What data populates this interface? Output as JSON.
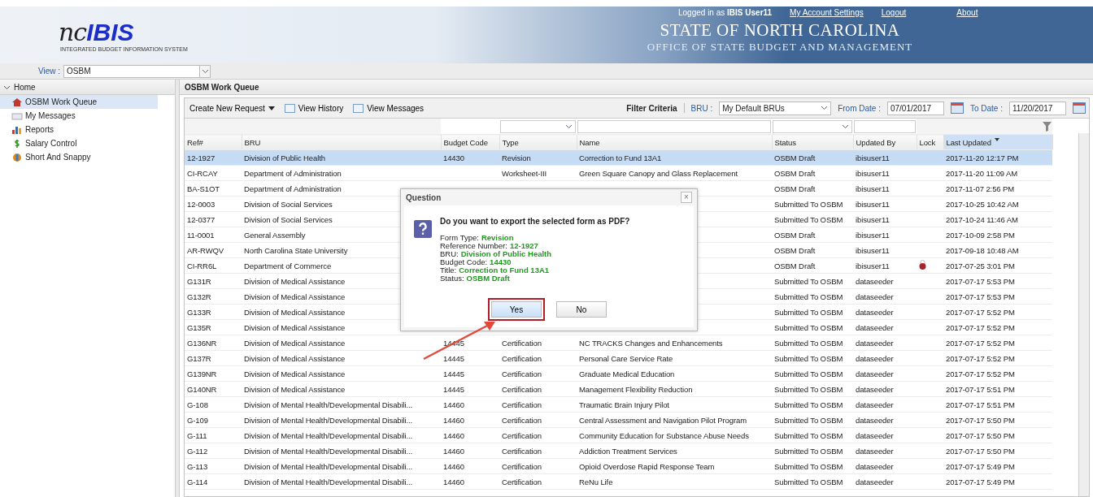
{
  "header": {
    "logo_script": "nc",
    "logo_bold": "IBIS",
    "logo_tagline": "INTEGRATED BUDGET INFORMATION SYSTEM",
    "login_text": "Logged in as **IBIS User11**",
    "links": [
      "My Account Settings",
      "Logout",
      "About"
    ],
    "title": "STATE OF NORTH CAROLINA",
    "subtitle": "OFFICE OF STATE BUDGET AND MANAGEMENT"
  },
  "view": {
    "label": "View :",
    "value": "OSBM"
  },
  "sidebar": {
    "root": {
      "label": "Home",
      "expanded": true,
      "children": [
        {
          "label": "OSBM Work Queue",
          "kind": "house",
          "selected": true
        },
        {
          "label": "My Messages",
          "kind": "mail",
          "selected": false
        },
        {
          "label": "Reports",
          "kind": "chart",
          "selected": false
        },
        {
          "label": "Salary Control",
          "kind": "dollar",
          "selected": false
        },
        {
          "label": "Short And Snappy",
          "kind": "flash",
          "selected": false
        }
      ]
    }
  },
  "panel": {
    "title": "OSBM Work Queue",
    "toolbar": {
      "create": "Create New Request",
      "history": "View History",
      "messages": "View Messages"
    },
    "filter": {
      "label": "Filter Criteria",
      "bru_label": "BRU :",
      "bru_value": "My Default BRUs",
      "from_label": "From Date :",
      "from_value": "07/01/2017",
      "to_label": "To Date :",
      "to_value": "11/20/2017"
    },
    "columns": [
      {
        "label": "Ref#",
        "sorted": false
      },
      {
        "label": "BRU",
        "sorted": false
      },
      {
        "label": "Budget Code",
        "sorted": false
      },
      {
        "label": "Type",
        "sorted": false
      },
      {
        "label": "Name",
        "sorted": false
      },
      {
        "label": "Status",
        "sorted": false
      },
      {
        "label": "Updated By",
        "sorted": false
      },
      {
        "label": "Lock",
        "sorted": false
      },
      {
        "label": "Last Updated",
        "sorted": true
      }
    ],
    "rows": [
      {
        "ref": "12-1927",
        "bru": "Division of Public Health",
        "budget_code": "14430",
        "type": "Revision",
        "name": "Correction to Fund 13A1",
        "status": "OSBM Draft",
        "updated_by": "ibisuser11",
        "locked": false,
        "last_updated": "2017-11-20 12:17 PM",
        "selected": true
      },
      {
        "ref": "CI-RCAY",
        "bru": "Department of Administration",
        "type": "Worksheet-III",
        "name": "Green Square Canopy and Glass Replacement",
        "status": "OSBM Draft",
        "updated_by": "ibisuser11",
        "locked": false,
        "last_updated": "2017-11-20 11:09 AM",
        "selected": false
      },
      {
        "ref": "BA-S1OT",
        "bru": "Department of Administration",
        "status": "OSBM Draft",
        "updated_by": "ibisuser11",
        "locked": false,
        "last_updated": "2017-11-07 2:56 PM",
        "selected": false
      },
      {
        "ref": "12-0003",
        "bru": "Division of Social Services",
        "status": "Submitted To OSBM",
        "updated_by": "ibisuser11",
        "locked": false,
        "last_updated": "2017-10-25 10:42 AM",
        "selected": false
      },
      {
        "ref": "12-0377",
        "bru": "Division of Social Services",
        "status": "Submitted To OSBM",
        "updated_by": "ibisuser11",
        "locked": false,
        "last_updated": "2017-10-24 11:46 AM",
        "selected": false
      },
      {
        "ref": "11-0001",
        "bru": "General Assembly",
        "status": "OSBM Draft",
        "updated_by": "ibisuser11",
        "locked": false,
        "last_updated": "2017-10-09 2:58 PM",
        "selected": false
      },
      {
        "ref": "AR-RWQV",
        "bru": "North Carolina State University",
        "status": "OSBM Draft",
        "updated_by": "ibisuser11",
        "locked": false,
        "last_updated": "2017-09-18 10:48 AM",
        "selected": false
      },
      {
        "ref": "CI-RR6L",
        "bru": "Department of Commerce",
        "status": "OSBM Draft",
        "updated_by": "ibisuser11",
        "locked": true,
        "last_updated": "2017-07-25 3:01 PM",
        "selected": false
      },
      {
        "ref": "G131R",
        "bru": "Division of Medical Assistance",
        "status": "Submitted To OSBM",
        "updated_by": "dataseeder",
        "locked": false,
        "last_updated": "2017-07-17 5:53 PM",
        "selected": false
      },
      {
        "ref": "G132R",
        "bru": "Division of Medical Assistance",
        "status": "Submitted To OSBM",
        "updated_by": "dataseeder",
        "locked": false,
        "last_updated": "2017-07-17 5:53 PM",
        "selected": false
      },
      {
        "ref": "G133R",
        "bru": "Division of Medical Assistance",
        "status": "Submitted To OSBM",
        "updated_by": "dataseeder",
        "locked": false,
        "last_updated": "2017-07-17 5:52 PM",
        "selected": false
      },
      {
        "ref": "G135R",
        "bru": "Division of Medical Assistance",
        "status": "Submitted To OSBM",
        "updated_by": "dataseeder",
        "locked": false,
        "last_updated": "2017-07-17 5:52 PM",
        "selected": false
      },
      {
        "ref": "G136NR",
        "bru": "Division of Medical Assistance",
        "budget_code": "14445",
        "type": "Certification",
        "name": "NC TRACKS Changes and Enhancements",
        "status": "Submitted To OSBM",
        "updated_by": "dataseeder",
        "locked": false,
        "last_updated": "2017-07-17 5:52 PM",
        "selected": false
      },
      {
        "ref": "G137R",
        "bru": "Division of Medical Assistance",
        "budget_code": "14445",
        "type": "Certification",
        "name": "Personal Care Service Rate",
        "status": "Submitted To OSBM",
        "updated_by": "dataseeder",
        "locked": false,
        "last_updated": "2017-07-17 5:52 PM",
        "selected": false
      },
      {
        "ref": "G139NR",
        "bru": "Division of Medical Assistance",
        "budget_code": "14445",
        "type": "Certification",
        "name": "Graduate Medical Education",
        "status": "Submitted To OSBM",
        "updated_by": "dataseeder",
        "locked": false,
        "last_updated": "2017-07-17 5:52 PM",
        "selected": false
      },
      {
        "ref": "G140NR",
        "bru": "Division of Medical Assistance",
        "budget_code": "14445",
        "type": "Certification",
        "name": "Management Flexibility Reduction",
        "status": "Submitted To OSBM",
        "updated_by": "dataseeder",
        "locked": false,
        "last_updated": "2017-07-17 5:51 PM",
        "selected": false
      },
      {
        "ref": "G-108",
        "bru": "Division of Mental Health/Developmental Disabili...",
        "budget_code": "14460",
        "type": "Certification",
        "name": "Traumatic Brain Injury Pilot",
        "status": "Submitted To OSBM",
        "updated_by": "dataseeder",
        "locked": false,
        "last_updated": "2017-07-17 5:51 PM",
        "selected": false
      },
      {
        "ref": "G-109",
        "bru": "Division of Mental Health/Developmental Disabili...",
        "budget_code": "14460",
        "type": "Certification",
        "name": "Central Assessment and Navigation Pilot Program",
        "status": "Submitted To OSBM",
        "updated_by": "dataseeder",
        "locked": false,
        "last_updated": "2017-07-17 5:50 PM",
        "selected": false
      },
      {
        "ref": "G-111",
        "bru": "Division of Mental Health/Developmental Disabili...",
        "budget_code": "14460",
        "type": "Certification",
        "name": "Community Education for Substance Abuse Needs",
        "status": "Submitted To OSBM",
        "updated_by": "dataseeder",
        "locked": false,
        "last_updated": "2017-07-17 5:50 PM",
        "selected": false
      },
      {
        "ref": "G-112",
        "bru": "Division of Mental Health/Developmental Disabili...",
        "budget_code": "14460",
        "type": "Certification",
        "name": "Addiction Treatment Services",
        "status": "Submitted To OSBM",
        "updated_by": "dataseeder",
        "locked": false,
        "last_updated": "2017-07-17 5:50 PM",
        "selected": false
      },
      {
        "ref": "G-113",
        "bru": "Division of Mental Health/Developmental Disabili...",
        "budget_code": "14460",
        "type": "Certification",
        "name": "Opioid Overdose Rapid Response Team",
        "status": "Submitted To OSBM",
        "updated_by": "dataseeder",
        "locked": false,
        "last_updated": "2017-07-17 5:49 PM",
        "selected": false
      },
      {
        "ref": "G-114",
        "bru": "Division of Mental Health/Developmental Disabili...",
        "budget_code": "14460",
        "type": "Certification",
        "name": "ReNu Life",
        "status": "Submitted To OSBM",
        "updated_by": "dataseeder",
        "locked": false,
        "last_updated": "2017-07-17 5:49 PM",
        "selected": false
      }
    ]
  },
  "dialog": {
    "title": "Question",
    "close": "×",
    "question": "Do you want to export the selected form as PDF?",
    "details": [
      {
        "label": "Form Type:",
        "value": "Revision"
      },
      {
        "label": "Reference Number:",
        "value": "12-1927"
      },
      {
        "label": "BRU:",
        "value": "Division of Public Health"
      },
      {
        "label": "Budget Code:",
        "value": "14430"
      },
      {
        "label": "Title:",
        "value": "Correction to Fund 13A1"
      },
      {
        "label": "Status:",
        "value": "OSBM Draft"
      }
    ],
    "buttons": [
      {
        "label": "Yes",
        "callout": true
      },
      {
        "label": "No",
        "callout": false
      }
    ]
  }
}
